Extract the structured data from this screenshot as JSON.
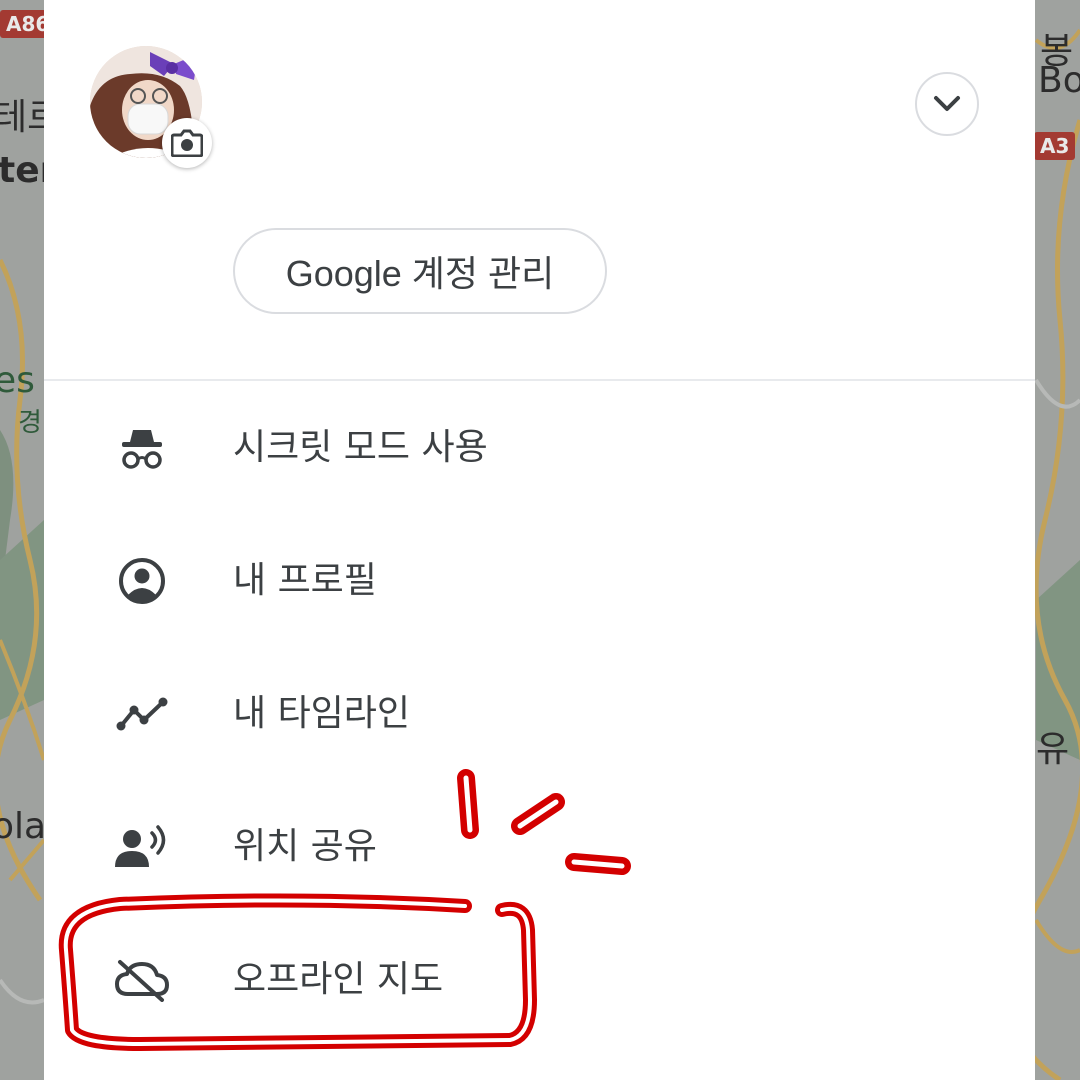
{
  "background_map": {
    "labels": [
      {
        "id": "korean-left",
        "text": "테르"
      },
      {
        "id": "latin-left",
        "text": "ter"
      },
      {
        "id": "green-left",
        "text": "es"
      },
      {
        "id": "green-left-2",
        "text": "경"
      },
      {
        "id": "play-left",
        "text": "olay"
      },
      {
        "id": "korean-right",
        "text": "봉"
      },
      {
        "id": "latin-right",
        "text": "Bor"
      },
      {
        "id": "korean-right-2",
        "text": "유"
      }
    ],
    "badges": [
      {
        "id": "road-a86",
        "text": "A86"
      },
      {
        "id": "road-a3",
        "text": "A3"
      }
    ]
  },
  "account": {
    "avatar_icon": "profile-photo",
    "camera_icon": "camera-icon",
    "expand_icon": "chevron-down-icon",
    "manage_label": "Google 계정 관리"
  },
  "menu": {
    "items": [
      {
        "label": "시크릿 모드 사용",
        "icon": "incognito-icon"
      },
      {
        "label": "내 프로필",
        "icon": "account-circle-icon"
      },
      {
        "label": "내 타임라인",
        "icon": "timeline-icon"
      },
      {
        "label": "위치 공유",
        "icon": "location-sharing-icon"
      },
      {
        "label": "오프라인 지도",
        "icon": "cloud-off-icon"
      }
    ]
  },
  "colors": {
    "text": "#3c4043",
    "border": "#dadce0",
    "annotation": "#d30000"
  }
}
